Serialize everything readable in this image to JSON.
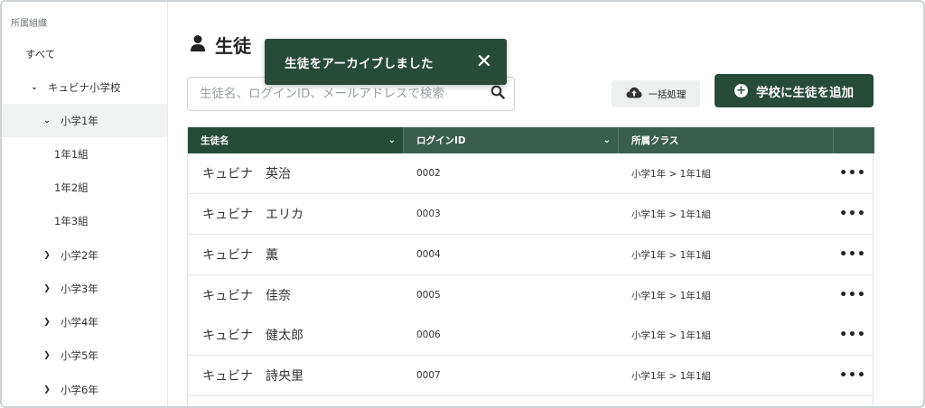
{
  "sidebar": {
    "title": "所属組織",
    "items": [
      {
        "label": "すべて",
        "chevron": ""
      },
      {
        "label": "キュビナ小学校",
        "chevron": "down"
      },
      {
        "label": "小学1年",
        "chevron": "down",
        "selected": true
      },
      {
        "label": "1年1組",
        "chevron": ""
      },
      {
        "label": "1年2組",
        "chevron": ""
      },
      {
        "label": "1年3組",
        "chevron": ""
      },
      {
        "label": "小学2年",
        "chevron": "right"
      },
      {
        "label": "小学3年",
        "chevron": "right"
      },
      {
        "label": "小学4年",
        "chevron": "right"
      },
      {
        "label": "小学5年",
        "chevron": "right"
      },
      {
        "label": "小学6年",
        "chevron": "right"
      }
    ]
  },
  "header": {
    "title": "生徒",
    "icon": "user-icon"
  },
  "toast": {
    "message": "生徒をアーカイブしました",
    "close": "✕"
  },
  "search": {
    "placeholder": "生徒名、ログインID、メールアドレスで検索",
    "value": ""
  },
  "toolbar": {
    "bulk_label": "一括処理",
    "add_label": "学校に生徒を追加"
  },
  "table": {
    "columns": [
      "生徒名",
      "ログインID",
      "所属クラス"
    ],
    "rows": [
      {
        "name": "キュビナ　英治",
        "login_id": "0002",
        "class": "小学1年 > 1年1組"
      },
      {
        "name": "キュビナ　エリカ",
        "login_id": "0003",
        "class": "小学1年 > 1年1組"
      },
      {
        "name": "キュビナ　薫",
        "login_id": "0004",
        "class": "小学1年 > 1年1組"
      },
      {
        "name": "キュビナ　佳奈",
        "login_id": "0005",
        "class": "小学1年 > 1年1組"
      },
      {
        "name": "キュビナ　健太郎",
        "login_id": "0006",
        "class": "小学1年 > 1年1組"
      },
      {
        "name": "キュビナ　詩央里",
        "login_id": "0007",
        "class": "小学1年 > 1年1組"
      }
    ],
    "row_menu": "•••"
  },
  "colors": {
    "primary": "#274a39",
    "header": "#3b5d4f",
    "selected_bg": "#f1f2f2"
  }
}
